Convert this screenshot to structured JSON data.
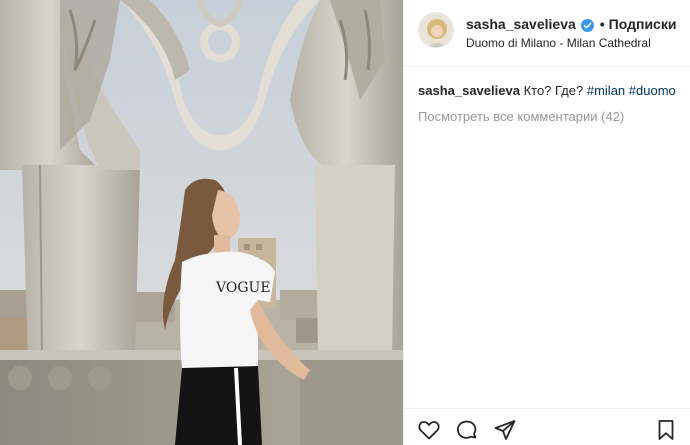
{
  "header": {
    "username": "sasha_savelieva",
    "separator": "•",
    "follow_label": "Подписки",
    "location": "Duomo di Milano - Milan Cathedral"
  },
  "caption": {
    "username": "sasha_savelieva",
    "text": "Кто? Где?",
    "hashtags": [
      "#milan",
      "#duomo"
    ]
  },
  "comments": {
    "view_all_label": "Посмотреть все комментарии (42)"
  },
  "photo": {
    "tshirt_print": "VOGUE"
  },
  "actions": {
    "icons": [
      "heart-icon",
      "comment-icon",
      "share-icon",
      "bookmark-icon"
    ]
  },
  "colors": {
    "text": "#262626",
    "hashtag": "#003569",
    "muted": "#999999",
    "verified": "#3897f0",
    "border": "#efefef"
  }
}
